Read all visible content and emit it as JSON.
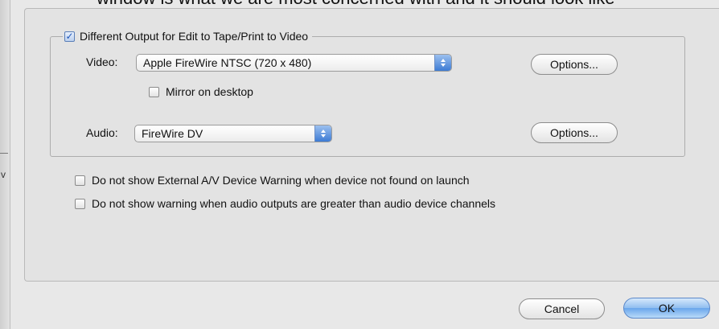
{
  "caption": "window is what we are most concerned with and it should look like",
  "left_mark": "v",
  "group": {
    "checkbox_label": "Different Output for Edit to Tape/Print to Video",
    "checked": true,
    "video": {
      "label": "Video:",
      "selected": "Apple FireWire NTSC (720 x 480)",
      "options_button": "Options..."
    },
    "mirror": {
      "label": "Mirror on desktop",
      "checked": false
    },
    "audio": {
      "label": "Audio:",
      "selected": "FireWire DV",
      "options_button": "Options..."
    }
  },
  "warnings": [
    {
      "label": "Do not show External A/V Device Warning when device not found on launch",
      "checked": false
    },
    {
      "label": "Do not show warning when audio outputs are greater than audio device channels",
      "checked": false
    }
  ],
  "footer": {
    "cancel_label": "Cancel",
    "ok_label": "OK"
  },
  "icons": {
    "check": "checkmark-icon",
    "popup": "up-down-arrows-icon"
  },
  "colors": {
    "accent": "#3d7bd4",
    "panel": "#e3e3e3"
  }
}
